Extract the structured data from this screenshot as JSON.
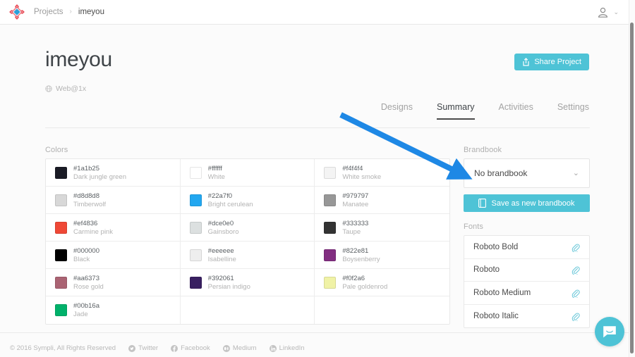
{
  "nav": {
    "logo_alt": "sympli-logo",
    "breadcrumb": {
      "root": "Projects",
      "separator": "›",
      "current": "imeyou"
    },
    "account_icon": "avatar-icon",
    "account_chevron": "⌄"
  },
  "hero": {
    "title": "imeyou",
    "platform_icon": "globe-icon",
    "platform": "Web@1x",
    "share_button": "Share Project",
    "share_icon": "share-icon"
  },
  "tabs": [
    {
      "label": "Designs",
      "active": false
    },
    {
      "label": "Summary",
      "active": true
    },
    {
      "label": "Activities",
      "active": false
    },
    {
      "label": "Settings",
      "active": false
    }
  ],
  "colors": {
    "section_label": "Colors",
    "items": [
      {
        "hex": "#1a1b25",
        "name": "Dark jungle green"
      },
      {
        "hex": "#ffffff",
        "name": "White"
      },
      {
        "hex": "#f4f4f4",
        "name": "White smoke"
      },
      {
        "hex": "#d8d8d8",
        "name": "Timberwolf"
      },
      {
        "hex": "#22a7f0",
        "name": "Bright cerulean"
      },
      {
        "hex": "#979797",
        "name": "Manatee"
      },
      {
        "hex": "#ef4836",
        "name": "Carmine pink"
      },
      {
        "hex": "#dce0e0",
        "name": "Gainsboro"
      },
      {
        "hex": "#333333",
        "name": "Taupe"
      },
      {
        "hex": "#000000",
        "name": "Black"
      },
      {
        "hex": "#eeeeee",
        "name": "Isabelline"
      },
      {
        "hex": "#822e81",
        "name": "Boysenberry"
      },
      {
        "hex": "#aa6373",
        "name": "Rose gold"
      },
      {
        "hex": "#392061",
        "name": "Persian indigo"
      },
      {
        "hex": "#f0f2a6",
        "name": "Pale goldenrod"
      },
      {
        "hex": "#00b16a",
        "name": "Jade"
      }
    ]
  },
  "brandbook": {
    "section_label": "Brandbook",
    "selected": "No brandbook",
    "select_chevron": "⌄",
    "save_button": "Save as new brandbook",
    "save_icon": "book-icon"
  },
  "fonts": {
    "section_label": "Fonts",
    "items": [
      {
        "name": "Roboto Bold",
        "icon": "paperclip-icon"
      },
      {
        "name": "Roboto",
        "icon": "paperclip-icon"
      },
      {
        "name": "Roboto Medium",
        "icon": "paperclip-icon"
      },
      {
        "name": "Roboto Italic",
        "icon": "paperclip-icon"
      }
    ]
  },
  "footer": {
    "copyright": "© 2016 Sympli, All Rights Reserved",
    "links": [
      {
        "label": "Twitter",
        "icon": "twitter-icon"
      },
      {
        "label": "Facebook",
        "icon": "facebook-icon"
      },
      {
        "label": "Medium",
        "icon": "medium-icon"
      },
      {
        "label": "LinkedIn",
        "icon": "linkedin-icon"
      }
    ]
  },
  "chat": {
    "icon": "chat-bubble-icon"
  },
  "annotation": {
    "type": "arrow",
    "color": "#1e88e5",
    "points_to": "Save as new brandbook"
  },
  "theme": {
    "accent": "#4ec3d6",
    "text_dark": "#4a4a4a",
    "text_muted": "#b0b0b0",
    "background": "#fbfbfb"
  }
}
